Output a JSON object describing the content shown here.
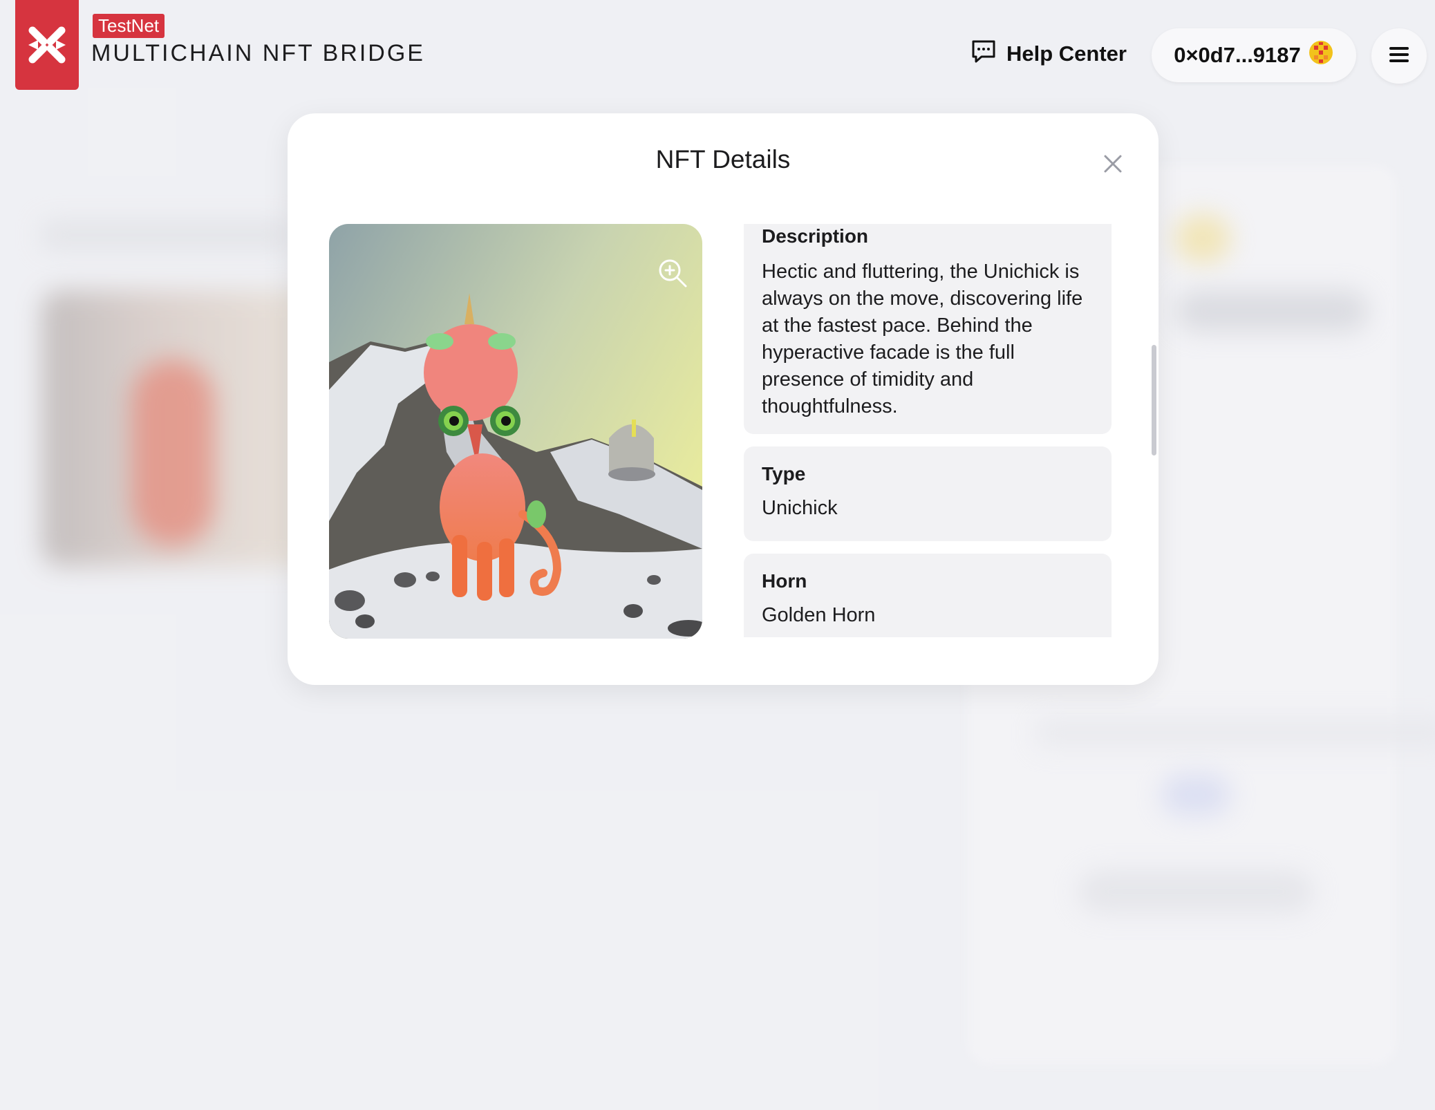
{
  "header": {
    "badge": "TestNet",
    "app_title": "MULTICHAIN NFT BRIDGE",
    "help_center": "Help Center",
    "wallet_address": "0×0d7...9187"
  },
  "modal": {
    "title": "NFT Details",
    "attributes": [
      {
        "label": "Description",
        "value": "Hectic and fluttering, the Unichick is always on the move, discovering life at the fastest pace. Behind the hyperactive facade is the full presence of timidity and thoughtfulness."
      },
      {
        "label": "Type",
        "value": "Unichick"
      },
      {
        "label": "Horn",
        "value": "Golden Horn"
      }
    ]
  },
  "icons": {
    "logo": "xp-logo-icon",
    "help": "chat-bubble-icon",
    "wallet_avatar": "avatar-icon",
    "menu": "hamburger-menu-icon",
    "close": "close-icon",
    "zoom": "zoom-in-icon"
  },
  "colors": {
    "brand_red": "#d6343f",
    "card_bg": "#f2f2f4",
    "page_bg": "#f2f3f6"
  }
}
